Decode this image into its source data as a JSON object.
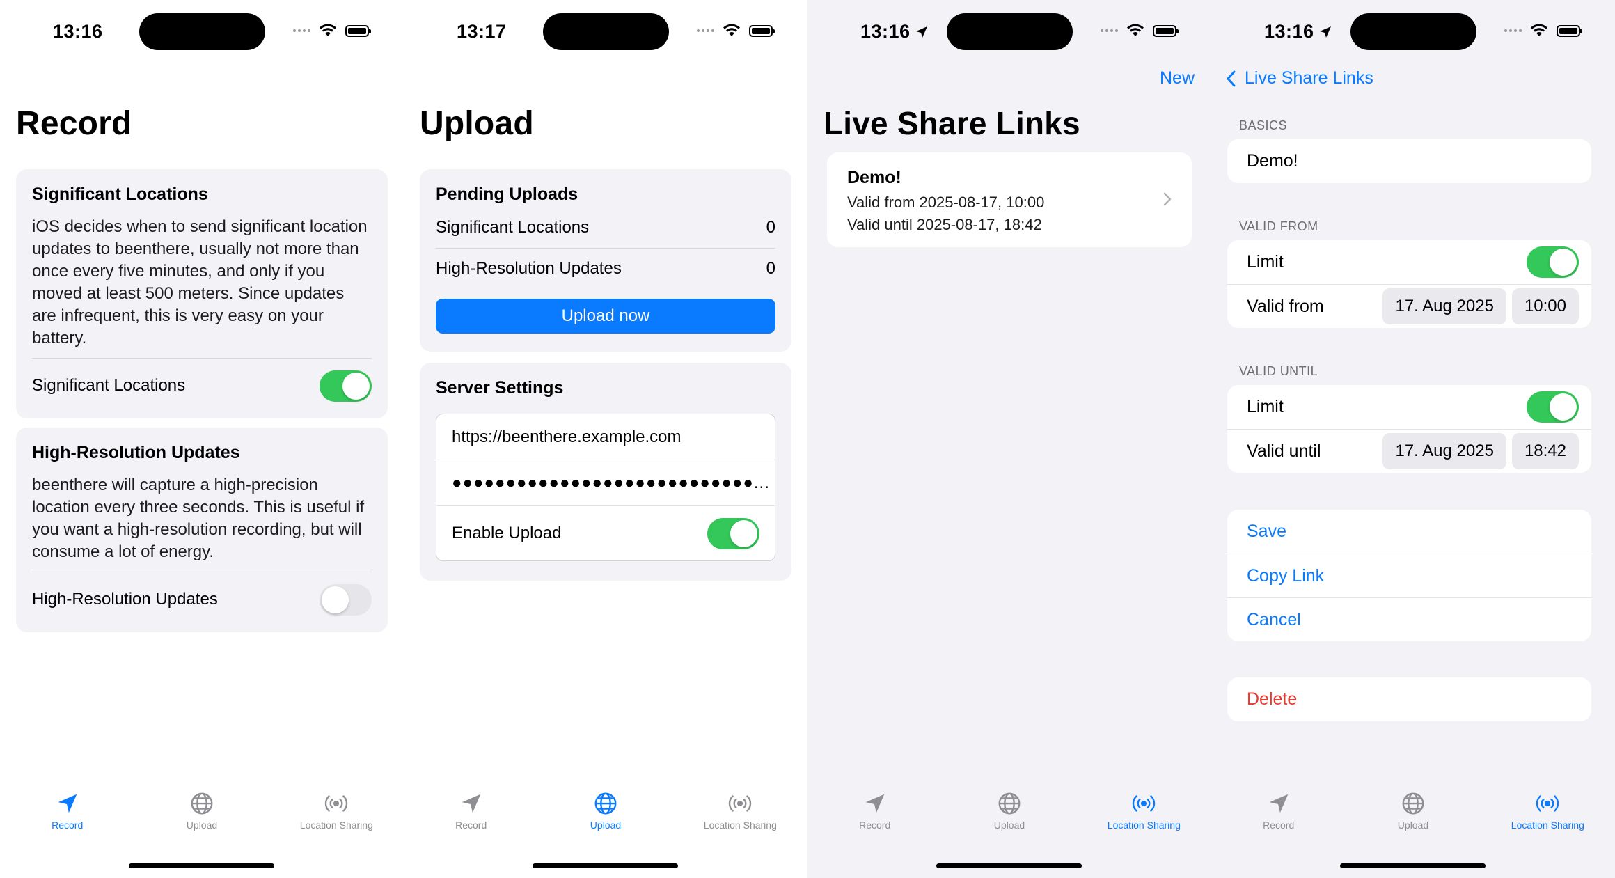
{
  "colors": {
    "accent": "#0a7aff",
    "toggle_on": "#34c759",
    "destructive": "#e5392f"
  },
  "tabs": [
    {
      "label": "Record",
      "icon": "location-arrow-icon"
    },
    {
      "label": "Upload",
      "icon": "globe-icon"
    },
    {
      "label": "Location Sharing",
      "icon": "broadcast-icon"
    }
  ],
  "screens": {
    "record": {
      "time": "13:16",
      "title": "Record",
      "significant": {
        "title": "Significant Locations",
        "body": "iOS decides when to send significant location updates to beenthere, usually not more than once every five minutes, and only if you moved at least 500 meters. Since updates are infrequent, this is very easy on your battery.",
        "toggle_label": "Significant Locations",
        "enabled": true
      },
      "highres": {
        "title": "High-Resolution Updates",
        "body": "beenthere will capture a high-precision location every three seconds. This is useful if you want a high-resolution recording, but will consume a lot of energy.",
        "toggle_label": "High-Resolution Updates",
        "enabled": false
      }
    },
    "upload": {
      "time": "13:17",
      "title": "Upload",
      "pending": {
        "title": "Pending Uploads",
        "rows": [
          {
            "label": "Significant Locations",
            "value": "0"
          },
          {
            "label": "High-Resolution Updates",
            "value": "0"
          }
        ],
        "button": "Upload now"
      },
      "server": {
        "title": "Server Settings",
        "url": "https://beenthere.example.com",
        "password": "●●●●●●●●●●●●●●●●●●●●●●●●●●●●...",
        "enable_label": "Enable Upload",
        "enabled": true
      }
    },
    "links": {
      "time": "13:16",
      "nav_new": "New",
      "title": "Live Share Links",
      "items": [
        {
          "name": "Demo!",
          "valid_from": "Valid from 2025-08-17, 10:00",
          "valid_until": "Valid until 2025-08-17, 18:42"
        }
      ]
    },
    "detail": {
      "time": "13:16",
      "back_label": "Live Share Links",
      "basics_header": "BASICS",
      "name": "Demo!",
      "valid_from_header": "VALID FROM",
      "valid_from_limit_label": "Limit",
      "valid_from_limit": true,
      "valid_from_label": "Valid from",
      "valid_from_date": "17. Aug 2025",
      "valid_from_time": "10:00",
      "valid_until_header": "VALID UNTIL",
      "valid_until_limit_label": "Limit",
      "valid_until_limit": true,
      "valid_until_label": "Valid until",
      "valid_until_date": "17. Aug 2025",
      "valid_until_time": "18:42",
      "actions": {
        "save": "Save",
        "copy": "Copy Link",
        "cancel": "Cancel"
      },
      "delete": "Delete"
    }
  }
}
